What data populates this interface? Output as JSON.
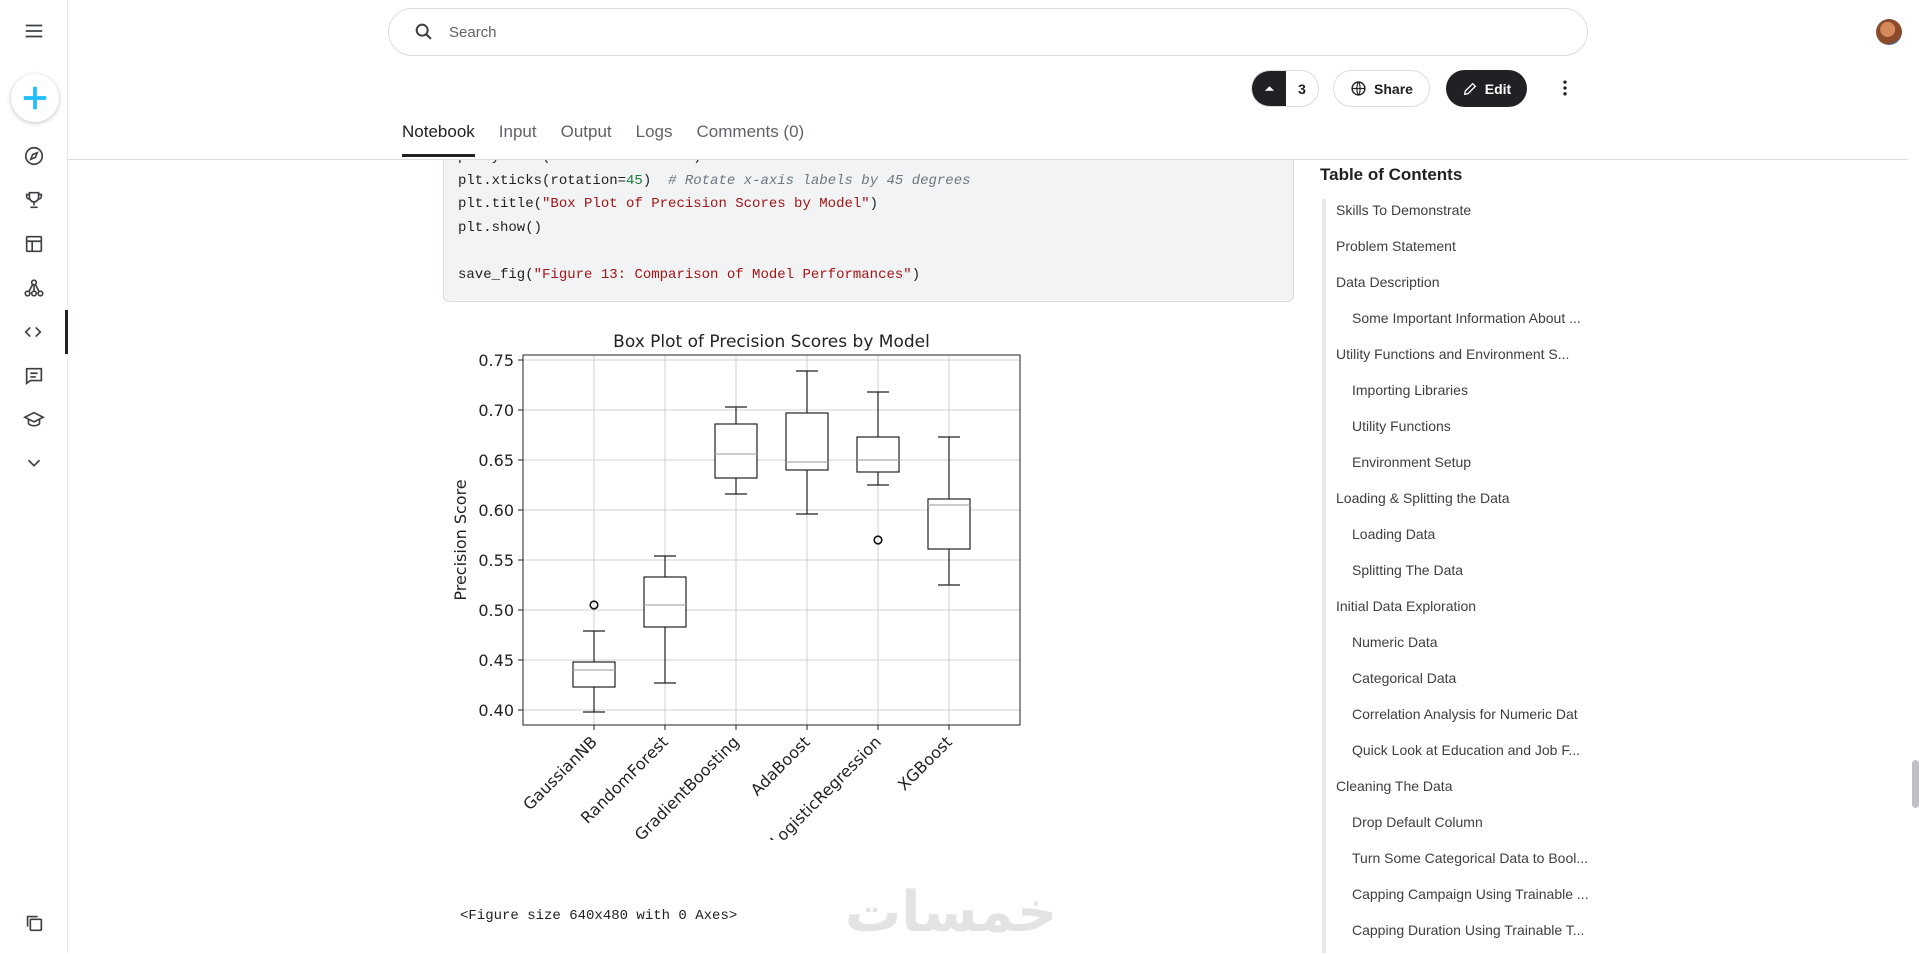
{
  "search": {
    "placeholder": "Search"
  },
  "actions": {
    "vote_count": "3",
    "share_label": "Share",
    "edit_label": "Edit"
  },
  "tabs": [
    {
      "label": "Notebook"
    },
    {
      "label": "Input"
    },
    {
      "label": "Output"
    },
    {
      "label": "Logs"
    },
    {
      "label": "Comments (0)"
    }
  ],
  "code": {
    "line1_partial": "plt.ylabel(\"Precision Score\")",
    "line2_code": "plt.xticks(rotation=",
    "line2_num": "45",
    "line2_close": ")  ",
    "line2_comment": "# Rotate x-axis labels by 45 degrees",
    "line3_pre": "plt.title(",
    "line3_str": "\"Box Plot of Precision Scores by Model\"",
    "line3_post": ")",
    "line4": "plt.show()",
    "line6_pre": "save_fig(",
    "line6_str": "\"Figure 13: Comparison of Model Performances\"",
    "line6_post": ")"
  },
  "output_text": "<Figure size 640x480 with 0 Axes>",
  "watermark": "خمسات",
  "chart_data": {
    "type": "box",
    "title": "Box Plot of Precision Scores by Model",
    "xlabel": "",
    "ylabel": "Precision Score",
    "ylim": [
      0.385,
      0.755
    ],
    "yticks": [
      "0.75",
      "0.70",
      "0.65",
      "0.60",
      "0.55",
      "0.50",
      "0.45",
      "0.40"
    ],
    "grid": true,
    "categories": [
      "GaussianNB",
      "RandomForest",
      "GradientBoosting",
      "AdaBoost",
      "LogisticRegression",
      "XGBoost"
    ],
    "boxes": [
      {
        "whislo": 0.398,
        "q1": 0.423,
        "med": 0.44,
        "q3": 0.448,
        "whishi": 0.479,
        "fliers": [
          0.505
        ]
      },
      {
        "whislo": 0.427,
        "q1": 0.483,
        "med": 0.505,
        "q3": 0.533,
        "whishi": 0.554,
        "fliers": []
      },
      {
        "whislo": 0.616,
        "q1": 0.632,
        "med": 0.656,
        "q3": 0.686,
        "whishi": 0.703,
        "fliers": []
      },
      {
        "whislo": 0.596,
        "q1": 0.64,
        "med": 0.648,
        "q3": 0.697,
        "whishi": 0.739,
        "fliers": []
      },
      {
        "whislo": 0.625,
        "q1": 0.638,
        "med": 0.65,
        "q3": 0.673,
        "whishi": 0.718,
        "fliers": [
          0.57
        ]
      },
      {
        "whislo": 0.525,
        "q1": 0.561,
        "med": 0.605,
        "q3": 0.611,
        "whishi": 0.673,
        "fliers": []
      }
    ]
  },
  "toc": {
    "title": "Table of Contents",
    "items": [
      {
        "label": "Skills To Demonstrate",
        "level": 1
      },
      {
        "label": "Problem Statement",
        "level": 1
      },
      {
        "label": "Data Description",
        "level": 1
      },
      {
        "label": "Some Important Information About ...",
        "level": 2
      },
      {
        "label": "Utility Functions and Environment S...",
        "level": 1
      },
      {
        "label": "Importing Libraries",
        "level": 2
      },
      {
        "label": "Utility Functions",
        "level": 2
      },
      {
        "label": "Environment Setup",
        "level": 2
      },
      {
        "label": "Loading & Splitting the Data",
        "level": 1
      },
      {
        "label": "Loading Data",
        "level": 2
      },
      {
        "label": "Splitting The Data",
        "level": 2
      },
      {
        "label": "Initial Data Exploration",
        "level": 1
      },
      {
        "label": "Numeric Data",
        "level": 2
      },
      {
        "label": "Categorical Data",
        "level": 2
      },
      {
        "label": "Correlation Analysis for Numeric Dat",
        "level": 2
      },
      {
        "label": "Quick Look at Education and Job F...",
        "level": 2
      },
      {
        "label": "Cleaning The Data",
        "level": 1
      },
      {
        "label": "Drop Default Column",
        "level": 2
      },
      {
        "label": "Turn Some Categorical Data to Bool...",
        "level": 2
      },
      {
        "label": "Capping Campaign Using Trainable ...",
        "level": 2
      },
      {
        "label": "Capping Duration Using Trainable T...",
        "level": 2
      }
    ]
  }
}
